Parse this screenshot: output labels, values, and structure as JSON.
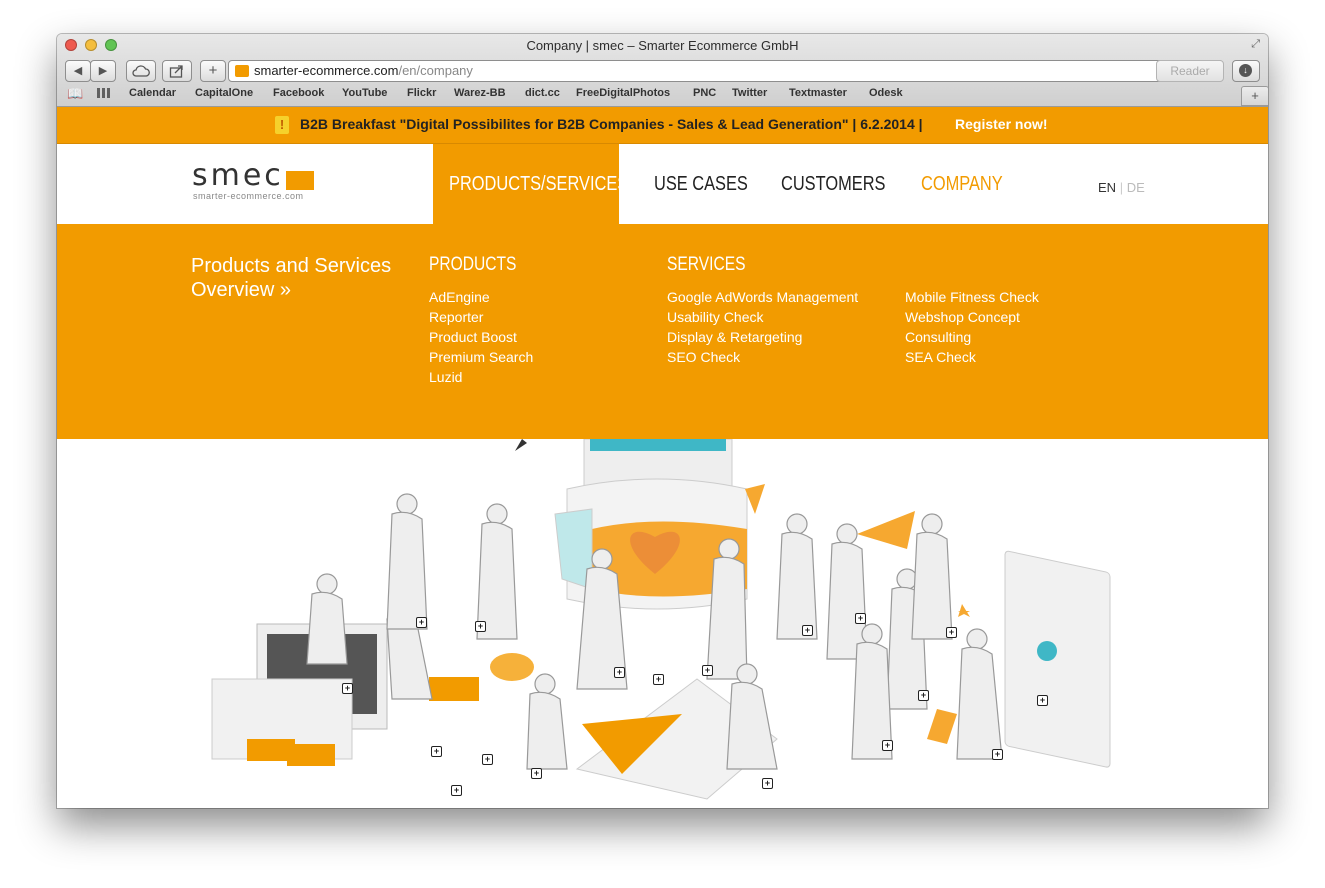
{
  "window": {
    "title": "Company | smec – Smarter Ecommerce GmbH"
  },
  "toolbar": {
    "back": "◀",
    "forward": "▶",
    "new_tab": "+",
    "reader": "Reader"
  },
  "address": {
    "host": "smarter-ecommerce.com",
    "path": "/en/company"
  },
  "bookmarks": [
    "Calendar",
    "CapitalOne",
    "Facebook",
    "YouTube",
    "Flickr",
    "Warez-BB",
    "dict.cc",
    "FreeDigitalPhotos",
    "PNC",
    "Twitter",
    "Textmaster",
    "Odesk"
  ],
  "banner": {
    "text": "B2B Breakfast \"Digital Possibilites for B2B Companies - Sales & Lead Generation\" | 6.2.2014 |",
    "link": "Register now!"
  },
  "logo": {
    "name": "smec",
    "sub": "smarter-ecommerce.com"
  },
  "nav": {
    "products": "PRODUCTS/SERVICES",
    "use_cases": "USE CASES",
    "customers": "CUSTOMERS",
    "company": "COMPANY"
  },
  "lang": {
    "en": "EN",
    "sep": "|",
    "de": "DE"
  },
  "mega": {
    "overview": "Products and Services Overview »",
    "products_head": "PRODUCTS",
    "products": [
      "AdEngine",
      "Reporter",
      "Product Boost",
      "Premium Search",
      "Luzid"
    ],
    "services_head": "SERVICES",
    "services_col1": [
      "Google AdWords Management",
      "Usability Check",
      "Display & Retargeting",
      "SEO Check"
    ],
    "services_col2": [
      "Mobile Fitness Check",
      "Webshop Concept",
      "Consulting",
      "SEA Check"
    ]
  },
  "colors": {
    "accent": "#f29b00"
  }
}
